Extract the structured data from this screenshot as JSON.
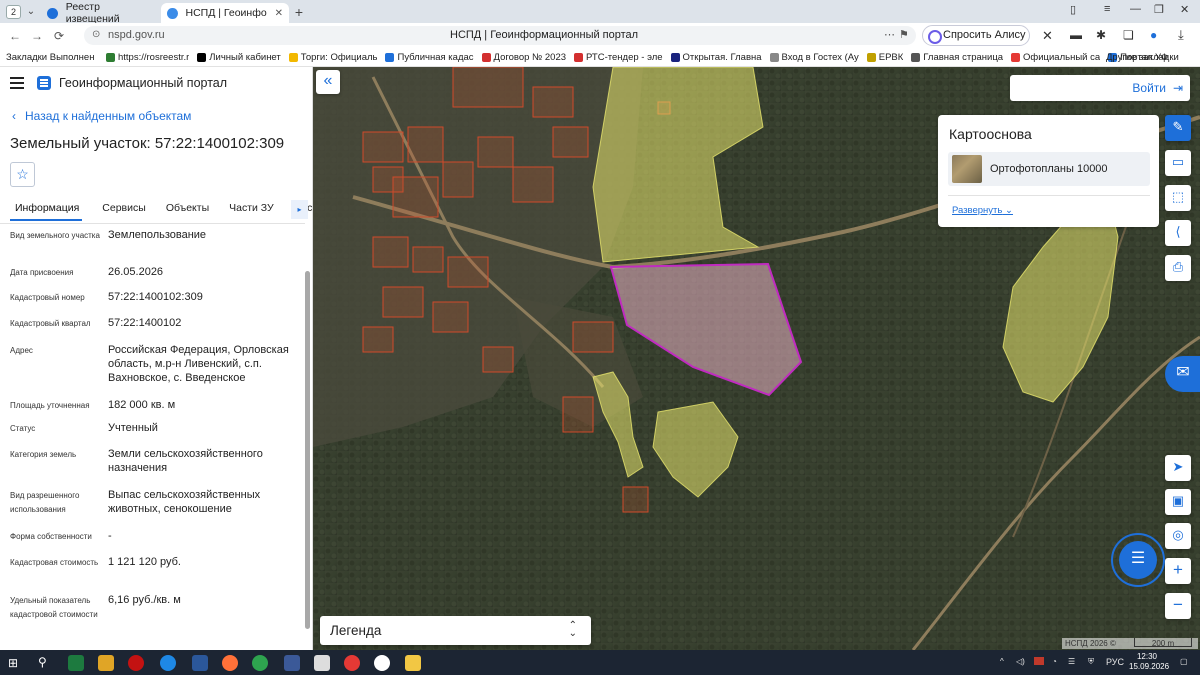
{
  "browser": {
    "tab_count": "2",
    "tabs": [
      {
        "title": "Реестр извещений",
        "active": false
      },
      {
        "title": "НСПД | Геоинформаци",
        "active": true
      }
    ],
    "url": "nspd.gov.ru",
    "page_title": "НСПД | Геоинформационный портал",
    "alisa_label": "Спросить Алису AI",
    "bookmarks": [
      {
        "label": "Закладки Выполнен",
        "color": "#ffffff"
      },
      {
        "label": "https://rosreestr.r",
        "color": "#2e7d32"
      },
      {
        "label": "Личный кабинет",
        "color": "#000000"
      },
      {
        "label": "Торги: Официаль",
        "color": "#f2b800"
      },
      {
        "label": "Публичная кадас",
        "color": "#1e6fd9"
      },
      {
        "label": "Договор № 2023",
        "color": "#d32f2f"
      },
      {
        "label": "РТС-тендер - эле",
        "color": "#d32f2f"
      },
      {
        "label": "Открытая. Главна",
        "color": "#1a237e"
      },
      {
        "label": "Вход в Гостех (Ау",
        "color": "#888888"
      },
      {
        "label": "ЕРВК",
        "color": "#c0a000"
      },
      {
        "label": "Главная страница",
        "color": "#555555"
      },
      {
        "label": "Официальный са",
        "color": "#e53935"
      },
      {
        "label": "Портал УФ",
        "color": "#1e6fd9"
      }
    ],
    "other_bookmarks": "Другие закладки"
  },
  "panel": {
    "app_title": "Геоинформационный портал",
    "back_label": "Назад к найденным объектам",
    "object_title": "Земельный участок: 57:22:1400102:309",
    "tabs": [
      "Информация",
      "Сервисы",
      "Объекты",
      "Части ЗУ",
      "Состав"
    ],
    "rows": [
      {
        "label": "Вид земельного участка",
        "value": "Землепользование"
      },
      {
        "label": "Дата присвоения",
        "value": "26.05.2026"
      },
      {
        "label": "Кадастровый номер",
        "value": "57:22:1400102:309"
      },
      {
        "label": "Кадастровый квартал",
        "value": "57:22:1400102"
      },
      {
        "label": "Адрес",
        "value": "Российская Федерация, Орловская область, м.р-н Ливенский, с.п. Вахновское, с. Введенское"
      },
      {
        "label": "Площадь уточненная",
        "value": "182 000 кв. м"
      },
      {
        "label": "Статус",
        "value": "Учтенный"
      },
      {
        "label": "Категория земель",
        "value": "Земли сельскохозяйственного назначения"
      },
      {
        "label": "Вид разрешенного использования",
        "value": "Выпас сельскохозяйственных животных, сенокошение"
      },
      {
        "label": "Форма собственности",
        "value": "-"
      },
      {
        "label": "Кадастровая стоимость",
        "value": "1 121 120 руб."
      },
      {
        "label": "Удельный показатель кадастровой стоимости",
        "value": "6,16 руб./кв. м"
      }
    ]
  },
  "map": {
    "login_label": "Войти",
    "basemap_title": "Картооснова",
    "basemap_item": "Ортофотопланы 10000",
    "expand_label": "Развернуть",
    "legend_label": "Легенда",
    "attribution": "НСПД 2026 ©",
    "scale_label": "200 m",
    "colors": {
      "selected_outline": "#c02bc0",
      "parcel_fill": "#e8e66e",
      "parcel_outline": "#d04a2a"
    }
  },
  "taskbar": {
    "lang": "РУС",
    "time": "12:30",
    "date": "15.09.2026"
  }
}
